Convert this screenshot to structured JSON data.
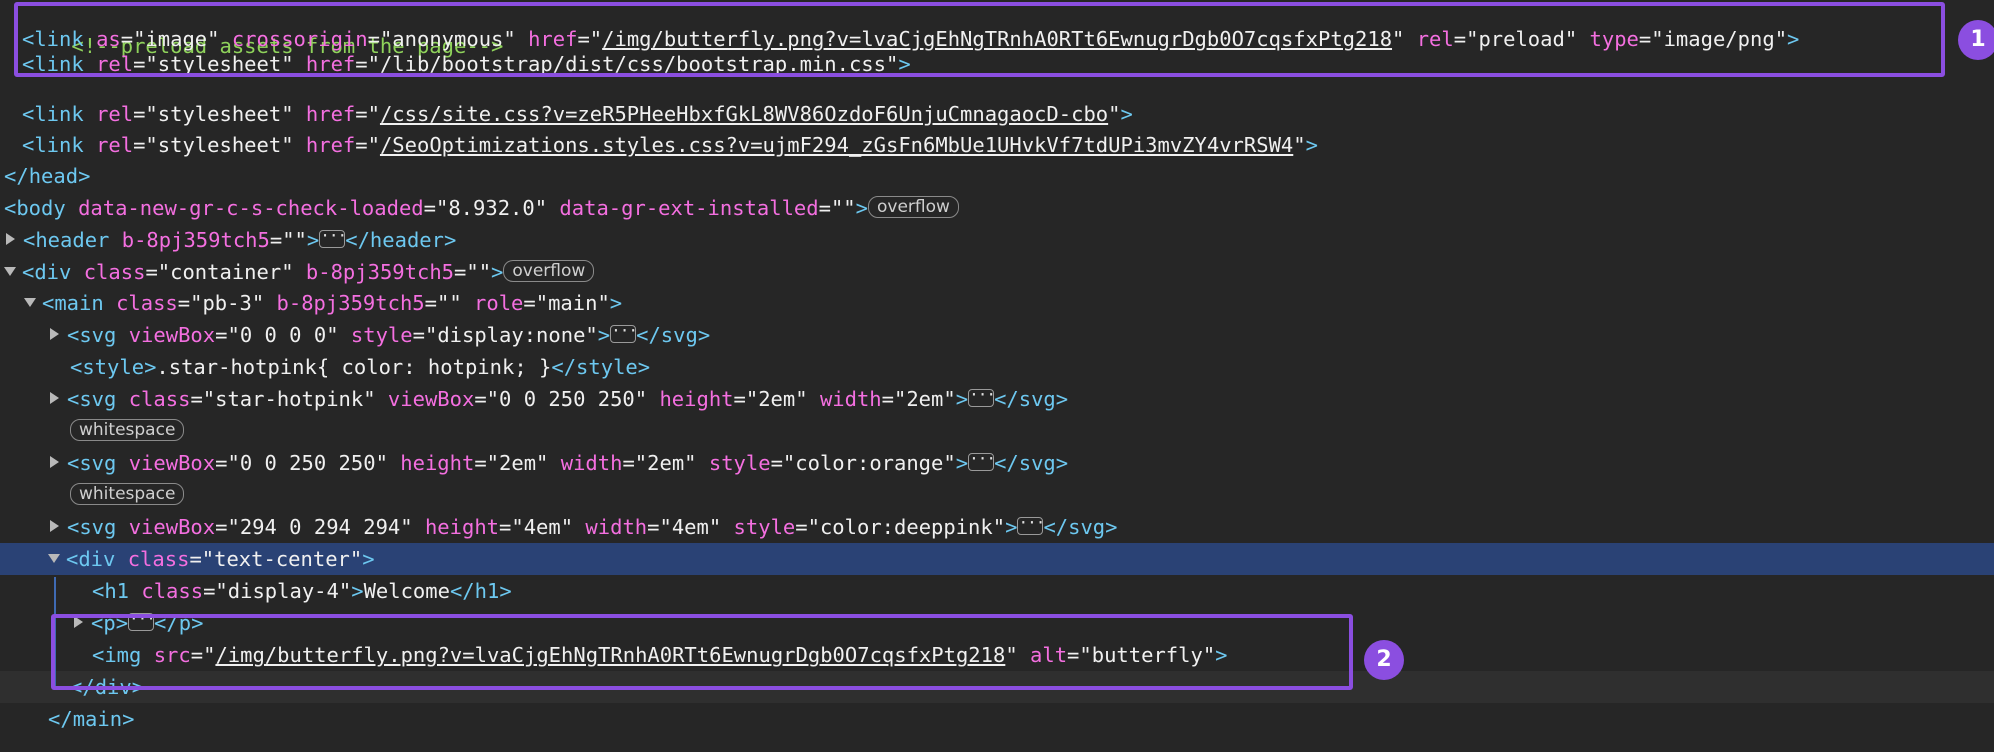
{
  "elements_panel": {
    "lines": [
      {
        "kind": "comment",
        "text": "<!--preload assets from the page-->"
      },
      {
        "kind": "link_preload",
        "tag": "link",
        "attrs": [
          {
            "name": "as",
            "value": "image"
          },
          {
            "name": "crossorigin",
            "value": "anonymous"
          },
          {
            "name": "href",
            "value": "/img/butterfly.png?v=lvaCjgEhNgTRnhA0RTt6EwnugrDgb0O7cqsfxPtg218",
            "link": true
          },
          {
            "name": "rel",
            "value": "preload"
          },
          {
            "name": "type",
            "value": "image/png"
          }
        ]
      },
      {
        "kind": "link_stylesheet",
        "tag": "link",
        "attrs": [
          {
            "name": "rel",
            "value": "stylesheet"
          },
          {
            "name": "href",
            "value": "/lib/bootstrap/dist/css/bootstrap.min.css",
            "link": true
          }
        ]
      },
      {
        "kind": "link_stylesheet",
        "tag": "link",
        "attrs": [
          {
            "name": "rel",
            "value": "stylesheet"
          },
          {
            "name": "href",
            "value": "/css/site.css?v=zeR5PHeeHbxfGkL8WV86OzdoF6UnjuCmnagaocD-cbo",
            "link": true
          }
        ]
      },
      {
        "kind": "link_stylesheet",
        "tag": "link",
        "attrs": [
          {
            "name": "rel",
            "value": "stylesheet"
          },
          {
            "name": "href",
            "value": "/SeoOptimizations.styles.css?v=ujmF294_zGsFn6MbUe1UHvkVf7tdUPi3mvZY4vrRSW4",
            "link": true
          }
        ]
      },
      {
        "kind": "close",
        "tag": "head"
      },
      {
        "kind": "body_open",
        "tag": "body",
        "attrs": [
          {
            "name": "data-new-gr-c-s-check-loaded",
            "value": "8.932.0"
          },
          {
            "name": "data-gr-ext-installed",
            "value": ""
          }
        ],
        "badge": "overflow"
      },
      {
        "kind": "collapsed",
        "tag": "header",
        "attrs": [
          {
            "name": "b-8pj359tch5",
            "value": ""
          }
        ]
      },
      {
        "kind": "open",
        "tag": "div",
        "attrs": [
          {
            "name": "class",
            "value": "container"
          },
          {
            "name": "b-8pj359tch5",
            "value": ""
          }
        ],
        "badge": "overflow"
      },
      {
        "kind": "open",
        "tag": "main",
        "attrs": [
          {
            "name": "class",
            "value": "pb-3"
          },
          {
            "name": "b-8pj359tch5",
            "value": ""
          },
          {
            "name": "role",
            "value": "main"
          }
        ]
      },
      {
        "kind": "collapsed",
        "tag": "svg",
        "attrs": [
          {
            "name": "viewBox",
            "value": "0 0 0 0"
          },
          {
            "name": "style",
            "value": "display:none"
          }
        ]
      },
      {
        "kind": "style",
        "tag": "style",
        "text": ".star-hotpink{ color: hotpink; }"
      },
      {
        "kind": "collapsed",
        "tag": "svg",
        "attrs": [
          {
            "name": "class",
            "value": "star-hotpink"
          },
          {
            "name": "viewBox",
            "value": "0 0 250 250"
          },
          {
            "name": "height",
            "value": "2em"
          },
          {
            "name": "width",
            "value": "2em"
          }
        ]
      },
      {
        "kind": "badge_line",
        "badge": "whitespace"
      },
      {
        "kind": "collapsed",
        "tag": "svg",
        "attrs": [
          {
            "name": "viewBox",
            "value": "0 0 250 250"
          },
          {
            "name": "height",
            "value": "2em"
          },
          {
            "name": "width",
            "value": "2em"
          },
          {
            "name": "style",
            "value": "color:orange"
          }
        ]
      },
      {
        "kind": "badge_line",
        "badge": "whitespace"
      },
      {
        "kind": "collapsed",
        "tag": "svg",
        "attrs": [
          {
            "name": "viewBox",
            "value": "294 0 294 294"
          },
          {
            "name": "height",
            "value": "4em"
          },
          {
            "name": "width",
            "value": "4em"
          },
          {
            "name": "style",
            "value": "color:deeppink"
          }
        ]
      },
      {
        "kind": "open",
        "tag": "div",
        "attrs": [
          {
            "name": "class",
            "value": "text-center"
          }
        ]
      },
      {
        "kind": "h1",
        "tag": "h1",
        "attrs": [
          {
            "name": "class",
            "value": "display-4"
          }
        ],
        "text": "Welcome"
      },
      {
        "kind": "collapsed",
        "tag": "p",
        "attrs": []
      },
      {
        "kind": "img",
        "tag": "img",
        "attrs": [
          {
            "name": "src",
            "value": "/img/butterfly.png?v=lvaCjgEhNgTRnhA0RTt6EwnugrDgb0O7cqsfxPtg218",
            "link": true
          },
          {
            "name": "alt",
            "value": "butterfly"
          }
        ]
      },
      {
        "kind": "close",
        "tag": "div"
      },
      {
        "kind": "close",
        "tag": "main"
      }
    ]
  },
  "annotations": [
    {
      "number": "1"
    },
    {
      "number": "2"
    }
  ],
  "colors": {
    "background": "#262626",
    "selected_row": "#2a4275",
    "annotation": "#8b4ee0",
    "tag": "#6dc8f0",
    "attribute": "#f46fe0",
    "comment": "#8fd35b"
  }
}
